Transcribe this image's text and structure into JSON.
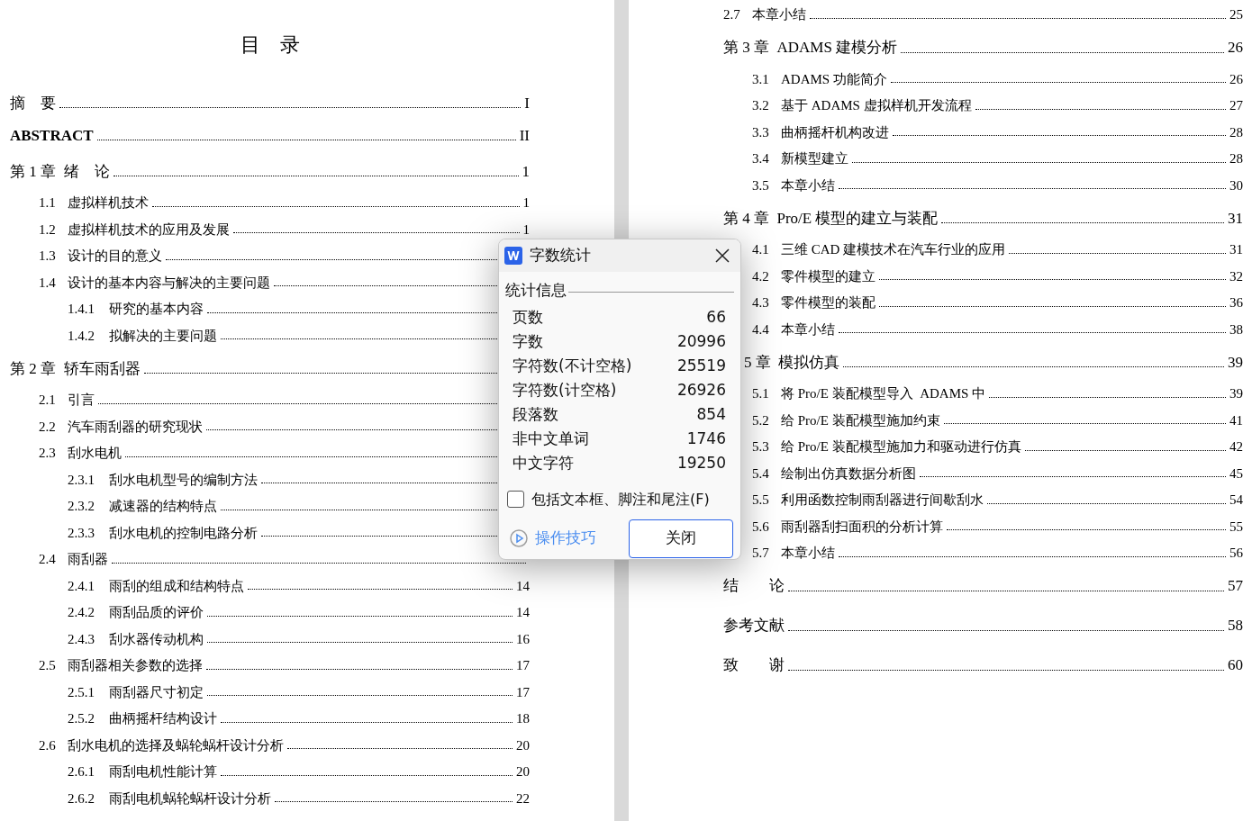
{
  "document": {
    "left_page": {
      "title": "目    录",
      "entries": [
        {
          "kind": "front",
          "label": "摘    要",
          "bold": false,
          "page": "I"
        },
        {
          "kind": "front",
          "label": "ABSTRACT",
          "bold": true,
          "page": "II"
        },
        {
          "kind": "chapter",
          "label": "第 1 章  绪    论",
          "page": "1",
          "children": [
            {
              "kind": "section",
              "number": "1.1",
              "title": "虚拟样机技术",
              "page": "1"
            },
            {
              "kind": "section",
              "number": "1.2",
              "title": "虚拟样机技术的应用及发展",
              "page": "1"
            },
            {
              "kind": "section",
              "number": "1.3",
              "title": "设计的目的意义"
            },
            {
              "kind": "section",
              "number": "1.4",
              "title": "设计的基本内容与解决的主要问题",
              "children": [
                {
                  "kind": "section",
                  "number": "1.4.1",
                  "title": "研究的基本内容"
                },
                {
                  "kind": "section",
                  "number": "1.4.2",
                  "title": "拟解决的主要问题"
                }
              ]
            }
          ]
        },
        {
          "kind": "chapter",
          "label": "第 2 章  轿车雨刮器",
          "children": [
            {
              "kind": "section",
              "number": "2.1",
              "title": "引言"
            },
            {
              "kind": "section",
              "number": "2.2",
              "title": "汽车雨刮器的研究现状"
            },
            {
              "kind": "section",
              "number": "2.3",
              "title": "刮水电机",
              "children": [
                {
                  "kind": "section",
                  "number": "2.3.1",
                  "title": "刮水电机型号的编制方法"
                },
                {
                  "kind": "section",
                  "number": "2.3.2",
                  "title": "减速器的结构特点"
                },
                {
                  "kind": "section",
                  "number": "2.3.3",
                  "title": "刮水电机的控制电路分析"
                }
              ]
            },
            {
              "kind": "section",
              "number": "2.4",
              "title": "雨刮器",
              "children": [
                {
                  "kind": "section",
                  "number": "2.4.1",
                  "title": "雨刮的组成和结构特点",
                  "page": "14"
                },
                {
                  "kind": "section",
                  "number": "2.4.2",
                  "title": "雨刮品质的评价",
                  "page": "14"
                },
                {
                  "kind": "section",
                  "number": "2.4.3",
                  "title": "刮水器传动机构",
                  "page": "16"
                }
              ]
            },
            {
              "kind": "section",
              "number": "2.5",
              "title": "雨刮器相关参数的选择",
              "page": "17",
              "children": [
                {
                  "kind": "section",
                  "number": "2.5.1",
                  "title": "雨刮器尺寸初定",
                  "page": "17"
                },
                {
                  "kind": "section",
                  "number": "2.5.2",
                  "title": "曲柄摇杆结构设计",
                  "page": "18"
                }
              ]
            },
            {
              "kind": "section",
              "number": "2.6",
              "title": "刮水电机的选择及蜗轮蜗杆设计分析",
              "page": "20",
              "children": [
                {
                  "kind": "section",
                  "number": "2.6.1",
                  "title": "雨刮电机性能计算",
                  "page": "20"
                },
                {
                  "kind": "section",
                  "number": "2.6.2",
                  "title": "雨刮电机蜗轮蜗杆设计分析",
                  "page": "22"
                }
              ]
            }
          ]
        }
      ]
    },
    "right_page": {
      "entries": [
        {
          "kind": "continued",
          "children": [
            {
              "kind": "section",
              "number": "2.7",
              "title": "本章小结",
              "page": "25"
            }
          ]
        },
        {
          "kind": "chapter",
          "label": "第 3 章  ADAMS 建模分析",
          "page": "26",
          "children": [
            {
              "kind": "section",
              "number": "3.1",
              "title": "ADAMS 功能简介",
              "page": "26"
            },
            {
              "kind": "section",
              "number": "3.2",
              "title": "基于 ADAMS 虚拟样机开发流程",
              "page": "27"
            },
            {
              "kind": "section",
              "number": "3.3",
              "title": "曲柄摇杆机构改进",
              "page": "28"
            },
            {
              "kind": "section",
              "number": "3.4",
              "title": "新模型建立",
              "page": "28"
            },
            {
              "kind": "section",
              "number": "3.5",
              "title": "本章小结",
              "page": "30"
            }
          ]
        },
        {
          "kind": "chapter",
          "label": "第 4 章  Pro/E 模型的建立与装配",
          "page": "31",
          "children": [
            {
              "kind": "section",
              "number": "4.1",
              "title": "三维 CAD 建模技术在汽车行业的应用",
              "page": "31"
            },
            {
              "kind": "section",
              "number": "4.2",
              "title": "零件模型的建立",
              "page": "32"
            },
            {
              "kind": "section",
              "number": "4.3",
              "title": "零件模型的装配",
              "page": "36"
            },
            {
              "kind": "section",
              "number": "4.4",
              "title": "本章小结",
              "page": "38"
            }
          ]
        },
        {
          "kind": "chapter-cut",
          "label": "5 章  模拟仿真",
          "page": "39",
          "children": [
            {
              "kind": "section",
              "number": "5.1",
              "title": "将 Pro/E 装配模型导入  ADAMS 中",
              "page": "39"
            },
            {
              "kind": "section",
              "number": "5.2",
              "title": "给 Pro/E 装配模型施加约束",
              "page": "41"
            },
            {
              "kind": "section",
              "number": "5.3",
              "title": "给 Pro/E 装配模型施加力和驱动进行仿真",
              "page": "42"
            },
            {
              "kind": "section",
              "number": "5.4",
              "title": "绘制出仿真数据分析图",
              "page": "45"
            },
            {
              "kind": "section",
              "number": "5.5",
              "title": "利用函数控制雨刮器进行间歇刮水",
              "page": "54"
            },
            {
              "kind": "section",
              "number": "5.6",
              "title": "雨刮器刮扫面积的分析计算",
              "page": "55"
            },
            {
              "kind": "section",
              "number": "5.7",
              "title": "本章小结",
              "page": "56"
            }
          ]
        },
        {
          "kind": "back",
          "label": "结        论",
          "page": "57"
        },
        {
          "kind": "back",
          "label": "参考文献",
          "page": "58"
        },
        {
          "kind": "back",
          "label": "致        谢",
          "page": "60"
        }
      ]
    }
  },
  "dialog": {
    "title": "字数统计",
    "group": "统计信息",
    "stats": [
      {
        "label": "页数",
        "value": "66"
      },
      {
        "label": "字数",
        "value": "20996"
      },
      {
        "label": "字符数(不计空格)",
        "value": "25519"
      },
      {
        "label": "字符数(计空格)",
        "value": "26926"
      },
      {
        "label": "段落数",
        "value": "854"
      },
      {
        "label": "非中文单词",
        "value": "1746"
      },
      {
        "label": "中文字符",
        "value": "19250"
      }
    ],
    "include_option": {
      "label": "包括文本框、脚注和尾注(F)",
      "checked": false
    },
    "tips_link": "操作技巧",
    "close_button": "关闭"
  }
}
